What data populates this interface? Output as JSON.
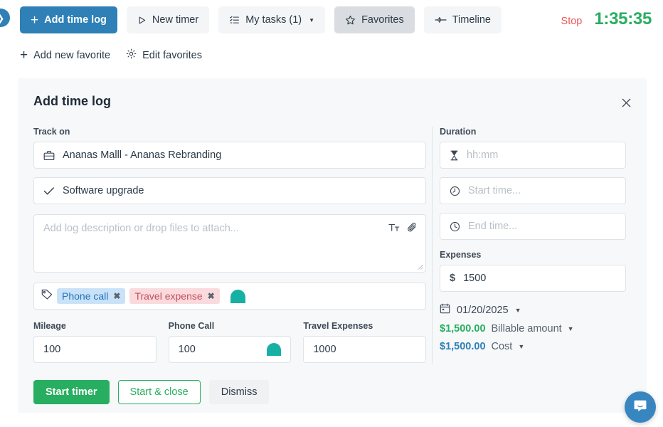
{
  "toolbar": {
    "collapse_icon": "chevron-right-icon",
    "add_time_log": "Add time log",
    "new_timer": "New timer",
    "my_tasks": "My tasks (1)",
    "favorites": "Favorites",
    "timeline": "Timeline",
    "stop_label": "Stop",
    "timer_value": "1:35:35"
  },
  "favbar": {
    "add_new_favorite": "Add new favorite",
    "edit_favorites": "Edit favorites"
  },
  "modal": {
    "title": "Add time log",
    "close_label": "×",
    "left": {
      "track_on_label": "Track on",
      "project_value": "Ananas Malll - Ananas Rebranding",
      "task_value": "Software upgrade",
      "description_placeholder": "Add log description or drop files to attach...",
      "tags": [
        {
          "label": "Phone call",
          "color": "#c9e2f8",
          "text_color": "#2172b8"
        },
        {
          "label": "Travel expense",
          "color": "#fadadd",
          "text_color": "#c0505c"
        }
      ],
      "chip_remove_glyph": "✖",
      "fields": [
        {
          "label": "Mileage",
          "value": "100",
          "has_arch_icon": false
        },
        {
          "label": "Phone Call",
          "value": "100",
          "has_arch_icon": true
        },
        {
          "label": "Travel Expenses",
          "value": "1000",
          "has_arch_icon": false
        }
      ]
    },
    "right": {
      "duration_label": "Duration",
      "duration_placeholder": "hh:mm",
      "start_time_placeholder": "Start time...",
      "end_time_placeholder": "End time...",
      "expenses_label": "Expenses",
      "currency_symbol": "$",
      "expenses_value": "1500",
      "date_value": "01/20/2025",
      "billable_amount": "$1,500.00",
      "billable_label": "Billable amount",
      "cost_amount": "$1,500.00",
      "cost_label": "Cost"
    },
    "buttons": {
      "start_timer": "Start timer",
      "start_and_close": "Start & close",
      "dismiss": "Dismiss"
    }
  },
  "launcher": {
    "icon": "chat-bubble-icon"
  }
}
